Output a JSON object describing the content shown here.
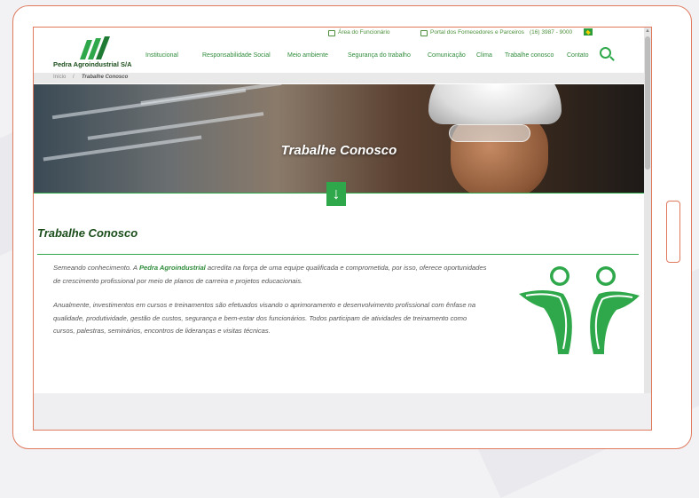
{
  "topbar": {
    "employee_area": "Área do Funcionário",
    "supplier_portal": "Portal dos Fornecedores e Parceiros",
    "phone": "(16) 3987 - 9000"
  },
  "logo": {
    "name": "Pedra Agroindustrial S/A"
  },
  "nav": {
    "items": [
      "Institucional",
      "Responsabilidade Social",
      "Meio ambiente",
      "Segurança do trabalho",
      "Comunicação",
      "Clima",
      "Trabalhe conosco",
      "Contato"
    ]
  },
  "breadcrumb": {
    "home": "Início",
    "separator": "/",
    "current": "Trabalhe Conosco"
  },
  "hero": {
    "title": "Trabalhe Conosco",
    "arrow": "↓"
  },
  "main": {
    "heading": "Trabalhe Conosco",
    "p1_before": "Semeando conhecimento. A ",
    "p1_brand": "Pedra Agroindustrial",
    "p1_after": " acredita na força de uma equipe qualificada e comprometida, por isso, oferece oportunidades de crescimento profissional por meio de planos de carreira e projetos educacionais.",
    "p2": "Anualmente, investimentos em cursos e treinamentos são efetuados visando o aprimoramento e desenvolvimento profissional com ênfase na qualidade, produtividade, gestão de custos, segurança e bem-estar dos funcionários. Todos participam de atividades de treinamento como cursos, palestras, seminários, encontros de lideranças e visitas técnicas."
  },
  "colors": {
    "brand_green": "#2ea84a",
    "dark_green": "#1a4d1a",
    "frame": "#e07a5f"
  },
  "icons": {
    "search": "search-icon",
    "lock": "lock-icon",
    "flag": "brazil-flag-icon"
  }
}
